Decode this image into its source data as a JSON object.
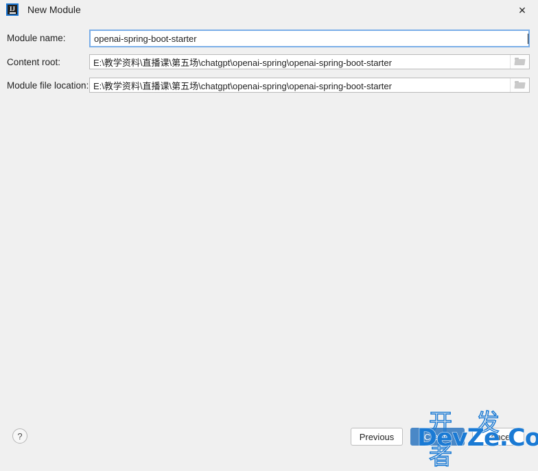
{
  "window": {
    "title": "New Module",
    "app_icon": "intellij-idea-icon",
    "close_label": "✕"
  },
  "form": {
    "fields": [
      {
        "label": "Module name:",
        "value": "openai-spring-boot-starter",
        "focused": true,
        "has_browse": false
      },
      {
        "label": "Content root:",
        "value": "E:\\教学资料\\直播课\\第五场\\chatgpt\\openai-spring\\openai-spring-boot-starter",
        "focused": false,
        "has_browse": true,
        "browse_icon": "folder-icon"
      },
      {
        "label": "Module file location:",
        "value": "E:\\教学资料\\直播课\\第五场\\chatgpt\\openai-spring\\openai-spring-boot-starter",
        "focused": false,
        "has_browse": true,
        "browse_icon": "folder-icon"
      }
    ]
  },
  "footer": {
    "help_label": "?",
    "previous_label": "Previous",
    "create_label": "Create",
    "cancel_label": "Cancel"
  },
  "watermark": {
    "chinese": "开 发 者",
    "english": "DevZe.CoM"
  },
  "colors": {
    "background": "#f0f0f0",
    "focus_border": "#7aaee8",
    "primary_button": "#4a88c7",
    "field_border": "#b9b9b9",
    "watermark_blue": "#1a7ad4"
  }
}
